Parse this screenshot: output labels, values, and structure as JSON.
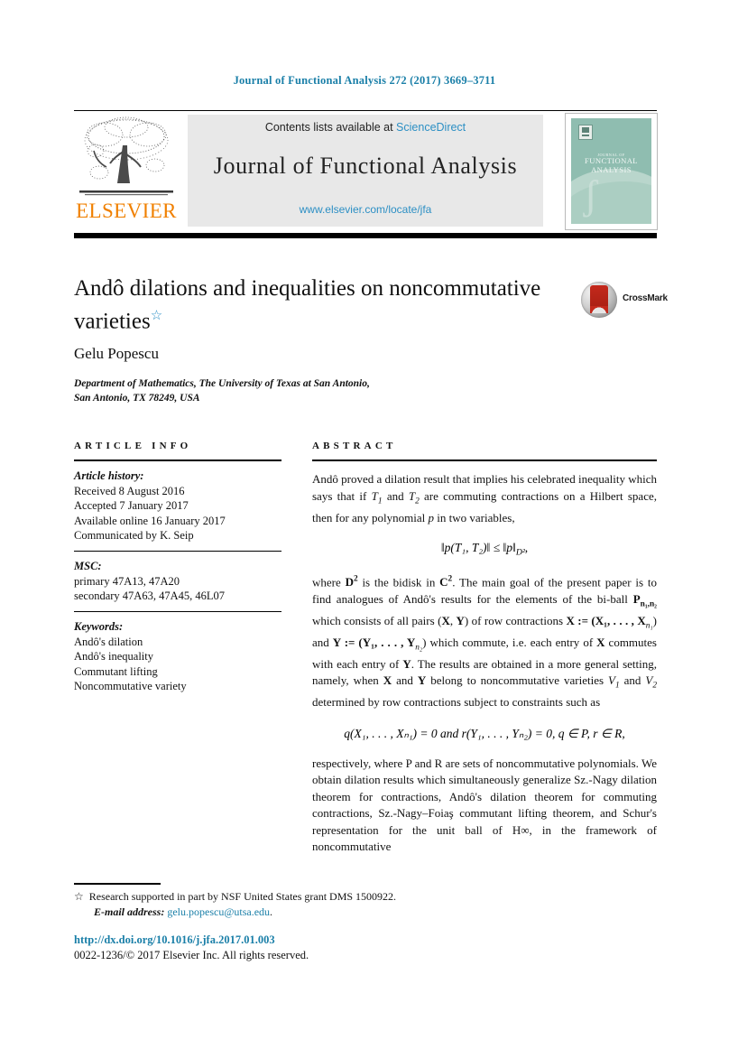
{
  "running_head": "Journal of Functional Analysis 272 (2017) 3669–3711",
  "banner": {
    "contents_prefix": "Contents lists available at ",
    "sciencedirect": "ScienceDirect",
    "journal_name": "Journal of Functional Analysis",
    "journal_url": "www.elsevier.com/locate/jfa",
    "publisher": "ELSEVIER",
    "cover": {
      "line1": "JOURNAL OF",
      "line2": "FUNCTIONAL",
      "line3": "ANALYSIS"
    }
  },
  "article": {
    "title": "Andô dilations and inequalities on noncommutative varieties",
    "title_footnote_marker": "☆",
    "crossmark_label": "CrossMark",
    "author": "Gelu Popescu",
    "affiliation_line1": "Department of Mathematics, The University of Texas at San Antonio,",
    "affiliation_line2": "San Antonio, TX 78249, USA"
  },
  "info": {
    "heading": "ARTICLE INFO",
    "history_label": "Article history:",
    "history": [
      "Received 8 August 2016",
      "Accepted 7 January 2017",
      "Available online 16 January 2017",
      "Communicated by K. Seip"
    ],
    "msc_label": "MSC:",
    "msc": [
      "primary 47A13, 47A20",
      "secondary 47A63, 47A45, 46L07"
    ],
    "keywords_label": "Keywords:",
    "keywords": [
      "Andô's dilation",
      "Andô's inequality",
      "Commutant lifting",
      "Noncommutative variety"
    ]
  },
  "abstract": {
    "heading": "ABSTRACT",
    "para1_a": "Andô proved a dilation result that implies his celebrated inequality which says that if ",
    "para1_T1": "T",
    "para1_T1sub": "1",
    "para1_b": " and ",
    "para1_T2": "T",
    "para1_T2sub": "2",
    "para1_c": " are commuting contractions on a Hilbert space, then for any polynomial ",
    "para1_p": "p",
    "para1_d": " in two variables,",
    "equation1": "‖p(T₁, T₂)‖ ≤ ‖p‖",
    "equation1_sub": "D²",
    "para2_a": "where ",
    "para2_D": "D",
    "para2_Dsup": "2",
    "para2_b": " is the bidisk in ",
    "para2_C": "C",
    "para2_Csup": "2",
    "para2_c": ". The main goal of the present paper is to find analogues of Andô's results for the elements of the bi-ball ",
    "para2_P": "P",
    "para2_Psub": "n₁,n₂",
    "para2_d": " which consists of all pairs (",
    "para2_X": "X",
    "para2_e": ", ",
    "para2_Y": "Y",
    "para2_f": ") of row contractions ",
    "para2_Xdef": "X := (X₁, . . . , X",
    "para2_Xdefsub": "n₁",
    "para2_g": ") and ",
    "para2_Ydef": "Y := (Y₁, . . . , Y",
    "para2_Ydefsub": "n₂",
    "para2_h": ") which commute, i.e. each entry of ",
    "para2_i": " commutes with each entry of ",
    "para2_j": ". The results are obtained in a more general setting, namely, when ",
    "para2_k": " and ",
    "para2_l": " belong to noncommutative varieties ",
    "para2_V1": "V",
    "para2_V1sub": "1",
    "para2_m": " and ",
    "para2_V2": "V",
    "para2_V2sub": "2",
    "para2_n": " determined by row contractions subject to constraints such as",
    "equation2": "q(X₁, . . . , Xₙ₁) = 0   and   r(Y₁, . . . , Yₙ₂) = 0,    q ∈ P, r ∈ R,",
    "para3": "respectively, where P and R are sets of noncommutative polynomials. We obtain dilation results which simultaneously generalize Sz.-Nagy dilation theorem for contractions, Andô's dilation theorem for commuting contractions, Sz.-Nagy–Foiaş commutant lifting theorem, and Schur's representation for the unit ball of H∞, in the framework of noncommutative"
  },
  "footer": {
    "star": "☆",
    "funding": "Research supported in part by NSF United States grant DMS 1500922.",
    "email_label": "E-mail address:",
    "email": "gelu.popescu@utsa.edu",
    "email_period": ".",
    "doi": "http://dx.doi.org/10.1016/j.jfa.2017.01.003",
    "copyright": "0022-1236/© 2017 Elsevier Inc. All rights reserved."
  },
  "colors": {
    "link": "#1a7fa8",
    "sciencedirect": "#2c8fc4",
    "elsevier_orange": "#f08000",
    "cover_green": "#8fbdb0"
  }
}
